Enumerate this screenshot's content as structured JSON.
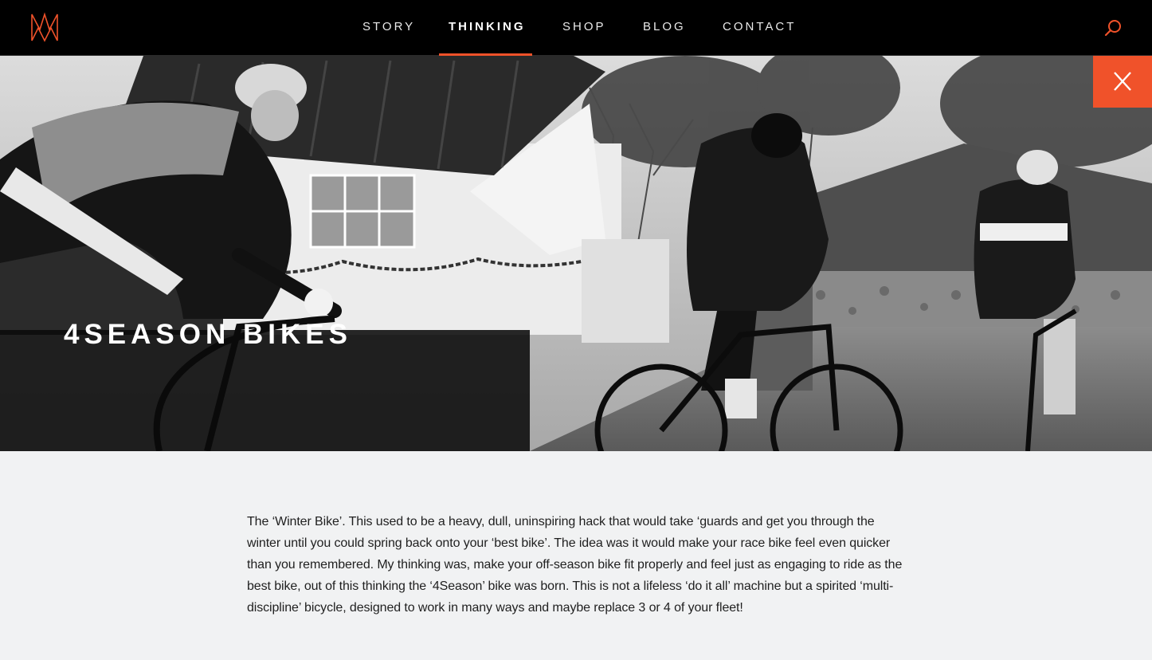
{
  "header": {
    "logo_icon": "m-monogram-logo-icon",
    "nav": [
      {
        "label": "STORY",
        "active": false
      },
      {
        "label": "THINKING",
        "active": true
      },
      {
        "label": "SHOP",
        "active": false
      },
      {
        "label": "BLOG",
        "active": false
      },
      {
        "label": "CONTACT",
        "active": false
      }
    ],
    "search_icon": "search-icon"
  },
  "hero": {
    "title": "4SEASON BIKES",
    "close_icon": "close-icon"
  },
  "article": {
    "body": "The ‘Winter Bike’. This used to be a heavy, dull, uninspiring hack that would take ‘guards and get you through the winter until you could spring back onto your ‘best bike’. The idea was it would make your race bike feel even quicker than you remembered. My thinking was, make your off-season bike fit properly and feel just as engaging to ride as the best bike, out of this thinking the ‘4Season’ bike was born. This is not a lifeless ‘do it all’ machine but a spirited ‘multi-discipline’ bicycle, designed to work in many ways and maybe replace 3 or 4 of your fleet!"
  },
  "colors": {
    "accent": "#f0522a",
    "header_bg": "#000000",
    "page_bg": "#f1f2f3",
    "text": "#1f1f1f"
  }
}
